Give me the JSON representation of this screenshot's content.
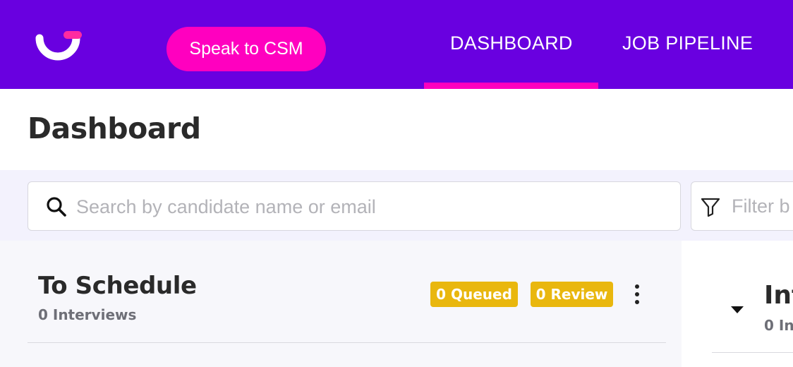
{
  "colors": {
    "brand": "#6900e0",
    "accent": "#ff00bf",
    "badge": "#e9b70e",
    "page_background": "#ffffff",
    "filter_strip": "#f3f2fd"
  },
  "header": {
    "logo_icon": "brand-logo-icon",
    "csm_button_label": "Speak to CSM",
    "nav": [
      {
        "label": "DASHBOARD",
        "active": true
      },
      {
        "label": "JOB PIPELINE",
        "active": false
      }
    ]
  },
  "page": {
    "title": "Dashboard"
  },
  "search": {
    "icon": "search-icon",
    "value": "",
    "placeholder": "Search by candidate name or email"
  },
  "filter": {
    "icon": "filter-funnel-icon",
    "placeholder": "Filter b"
  },
  "columns": [
    {
      "title": "To Schedule",
      "subtitle": "0 Interviews",
      "badges": [
        "0 Queued",
        "0 Review"
      ],
      "menu_icon": "more-vertical-icon"
    },
    {
      "title": "Int",
      "subtitle": "0 In",
      "toggle_icon": "caret-down-icon"
    }
  ]
}
